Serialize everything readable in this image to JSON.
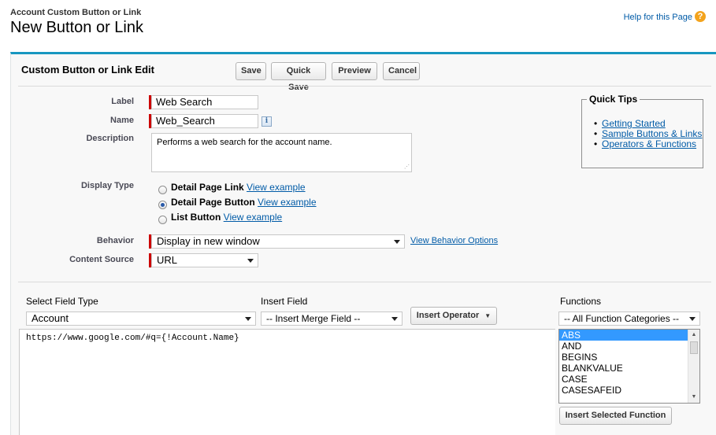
{
  "header": {
    "subtitle": "Account Custom Button or Link",
    "title": "New Button or Link",
    "help_link": "Help for this Page",
    "help_icon": "?"
  },
  "panel": {
    "title": "Custom Button or Link Edit",
    "buttons": {
      "save": "Save",
      "quick_save": "Quick Save",
      "preview": "Preview",
      "cancel": "Cancel"
    }
  },
  "form": {
    "label": {
      "caption": "Label",
      "value": "Web Search"
    },
    "name": {
      "caption": "Name",
      "value": "Web_Search",
      "info_icon": "i"
    },
    "description": {
      "caption": "Description",
      "value": "Performs a web search for the account name."
    },
    "display_type": {
      "caption": "Display Type",
      "options": [
        {
          "label": "Detail Page Link",
          "link": "View example",
          "selected": false
        },
        {
          "label": "Detail Page Button",
          "link": "View example",
          "selected": true
        },
        {
          "label": "List Button",
          "link": "View example",
          "selected": false
        }
      ]
    },
    "behavior": {
      "caption": "Behavior",
      "value": "Display in new window",
      "link": "View Behavior Options"
    },
    "content_source": {
      "caption": "Content Source",
      "value": "URL"
    }
  },
  "quick_tips": {
    "title": "Quick Tips",
    "items": [
      "Getting Started",
      "Sample Buttons & Links",
      "Operators & Functions"
    ]
  },
  "editor": {
    "select_field_type": {
      "caption": "Select Field Type",
      "value": "Account"
    },
    "insert_field": {
      "caption": "Insert Field",
      "value": "-- Insert Merge Field --"
    },
    "insert_operator": "Insert Operator",
    "functions": {
      "caption": "Functions",
      "category": "-- All Function Categories --",
      "list": [
        "ABS",
        "AND",
        "BEGINS",
        "BLANKVALUE",
        "CASE",
        "CASESAFEID"
      ],
      "selected_index": 0,
      "insert_button": "Insert Selected Function"
    },
    "formula": "https://www.google.com/#q={!Account.Name}"
  },
  "colors": {
    "accent": "#1797c0",
    "required": "#cc0000",
    "link": "#015ba7",
    "list_selection": "#3399ff"
  }
}
